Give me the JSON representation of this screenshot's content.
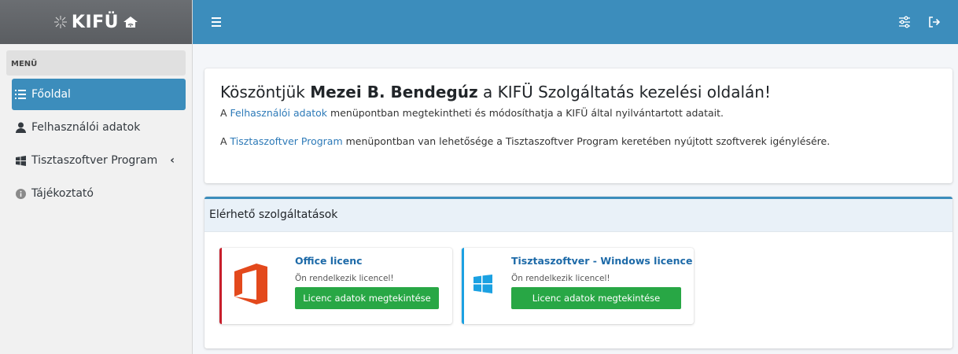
{
  "brand": {
    "name": "KIFÜ"
  },
  "sidebar": {
    "menu_header": "MENÜ",
    "items": [
      {
        "label": "Főoldal",
        "icon": "list-icon",
        "active": true
      },
      {
        "label": "Felhasználói adatok",
        "icon": "user-icon"
      },
      {
        "label": "Tisztaszoftver Program",
        "icon": "windows-icon",
        "chevron": "‹"
      },
      {
        "label": "Tájékoztató",
        "icon": "info-icon"
      }
    ]
  },
  "topbar": {
    "menu_icon": "hamburger-icon",
    "settings_icon": "sliders-icon",
    "logout_icon": "logout-icon"
  },
  "welcome": {
    "greeting_prefix": "Köszöntjük ",
    "user_name": "Mezei B. Bendegúz",
    "greeting_suffix": " a KIFÜ Szolgáltatás kezelési oldalán!",
    "line1_prefix": "A ",
    "line1_link": "Felhasználói adatok",
    "line1_suffix": " menüpontban megtekintheti és módosíthatja a KIFÜ által nyilvántartott adatait.",
    "line2_prefix": "A ",
    "line2_link": "Tisztaszoftver Program",
    "line2_suffix": " menüpontban van lehetősége a Tisztaszoftver Program keretében nyújtott szoftverek igénylésére."
  },
  "services": {
    "heading": "Elérhető szolgáltatások",
    "items": [
      {
        "title": "Office licenc",
        "status": "Ön rendelkezik licencel!",
        "button": "Licenc adatok megtekintése",
        "accent": "#c81e2b",
        "icon": "office-logo-icon"
      },
      {
        "title": "Tisztaszoftver - Windows licence",
        "status": "Ön rendelkezik licencel!",
        "button": "Licenc adatok megtekintése",
        "accent": "#1ba1e2",
        "icon": "windows-logo-icon"
      }
    ]
  },
  "colors": {
    "primary": "#3c8dbc",
    "success": "#28a745",
    "link": "#2d7ab8"
  }
}
